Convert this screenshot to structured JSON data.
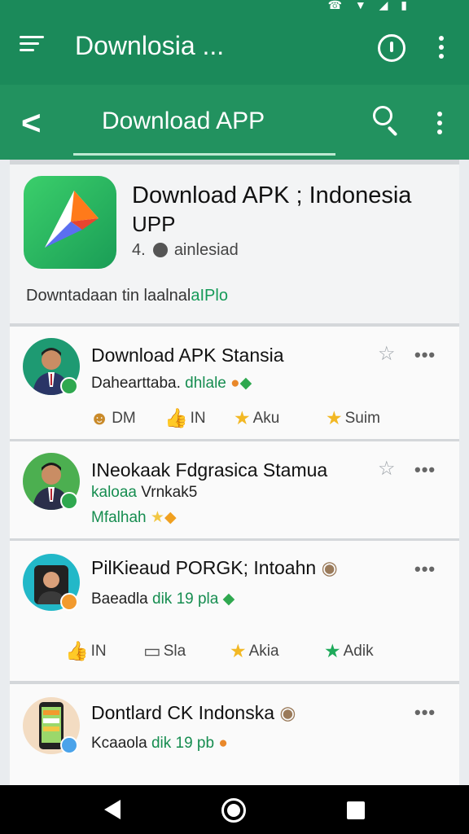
{
  "app_bar": {
    "title": "Downlosia ..."
  },
  "tab_bar": {
    "tab_label": "Download APP"
  },
  "app_card": {
    "title": "Download APK ; Indonesia",
    "subtitle": "UPP",
    "meta_prefix": "4.",
    "meta_text": "ainlesiad",
    "description_plain": "Downtadaan tin laalnal",
    "description_accent": "aIPlo",
    "colors": {
      "accent": "#159a58"
    }
  },
  "posts": [
    {
      "title": "Download APK Stansia",
      "sub_plain": "Dahearttaba.",
      "sub_accent": "dhlale",
      "star_icon": "☆",
      "more_label": "•••",
      "actions": [
        {
          "icon": "☻",
          "label": "DM"
        },
        {
          "icon": "👍",
          "label": "IN"
        },
        {
          "icon": "★",
          "label": "Aku"
        },
        {
          "icon": "★",
          "label": "Suim"
        }
      ]
    },
    {
      "title": "INeokaak Fdgrasica Stamua",
      "sub_accent": "kaloaa",
      "sub_plain": "Vrnkak5",
      "sub2_accent": "Mfalhah",
      "star_icon": "☆",
      "more_label": "•••"
    },
    {
      "title": "PilKieaud PORGK; Intoahn",
      "sub_plain": "Baeadla",
      "sub_accent": "dik 19 pla",
      "more_label": "•••",
      "actions": [
        {
          "icon": "👍",
          "label": "IN"
        },
        {
          "icon": "▭",
          "label": "Sla"
        },
        {
          "icon": "★",
          "label": "Akia"
        },
        {
          "icon": "★",
          "label": "Adik"
        }
      ]
    },
    {
      "title": "Dontlard CK Indonska",
      "sub_plain": "Kcaaola",
      "sub_accent": "dik 19 pb",
      "more_label": "•••"
    }
  ],
  "status_bar": {
    "icons": "☎ ▼ ◢ ▮"
  }
}
